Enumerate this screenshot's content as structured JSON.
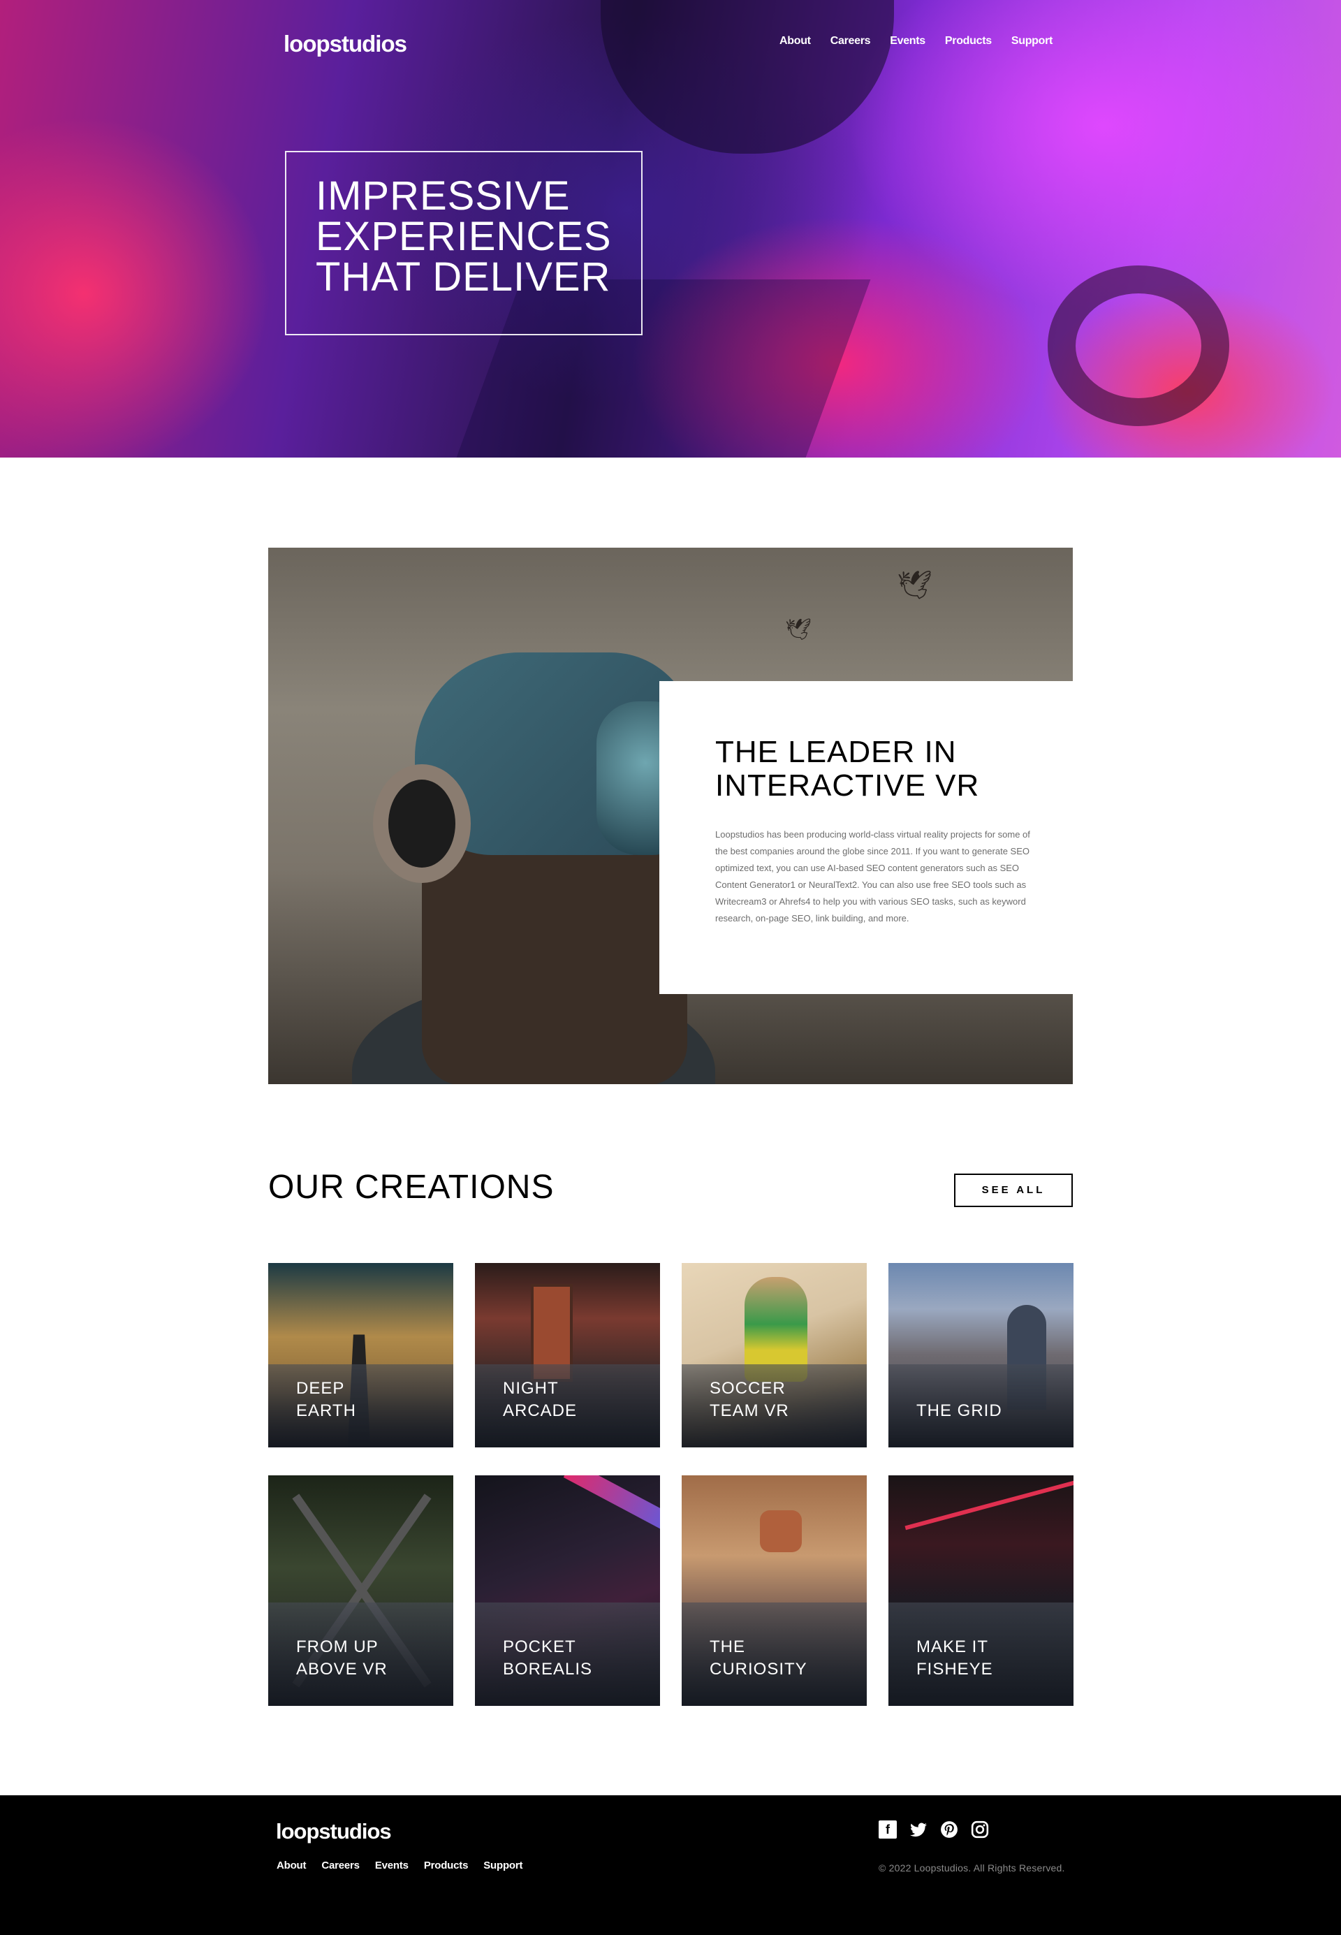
{
  "brand": {
    "logo": "loopstudios"
  },
  "nav": {
    "items": [
      {
        "label": "About"
      },
      {
        "label": "Careers"
      },
      {
        "label": "Events"
      },
      {
        "label": "Products"
      },
      {
        "label": "Support"
      }
    ]
  },
  "hero": {
    "title_lines": [
      "IMPRESSIVE",
      "EXPERIENCES",
      "THAT DELIVER"
    ]
  },
  "about": {
    "title_lines": [
      "THE LEADER IN",
      "INTERACTIVE VR"
    ],
    "body": "Loopstudios has been producing world-class virtual reality projects for some of the best companies around the globe since 2011. If you want to generate SEO optimized text, you can use AI-based SEO content generators such as SEO Content Generator1 or NeuralText2. You can also use free SEO tools such as Writecream3 or Ahrefs4 to help you with various SEO tasks, such as keyword research, on-page SEO, link building, and more."
  },
  "creations": {
    "title": "OUR CREATIONS",
    "see_all_label": "SEE ALL",
    "items": [
      {
        "lines": [
          "DEEP",
          "EARTH"
        ]
      },
      {
        "lines": [
          "NIGHT",
          "ARCADE"
        ]
      },
      {
        "lines": [
          "SOCCER",
          "TEAM VR"
        ]
      },
      {
        "lines": [
          "THE GRID",
          ""
        ]
      },
      {
        "lines": [
          "FROM UP",
          "ABOVE VR"
        ]
      },
      {
        "lines": [
          "POCKET",
          "BOREALIS"
        ]
      },
      {
        "lines": [
          "THE",
          "CURIOSITY"
        ]
      },
      {
        "lines": [
          "MAKE IT",
          "FISHEYE"
        ]
      }
    ]
  },
  "footer": {
    "logo": "loopstudios",
    "social_icons": [
      "facebook-icon",
      "twitter-icon",
      "pinterest-icon",
      "instagram-icon"
    ],
    "copyright": "© 2022 Loopstudios. All Rights Reserved."
  }
}
